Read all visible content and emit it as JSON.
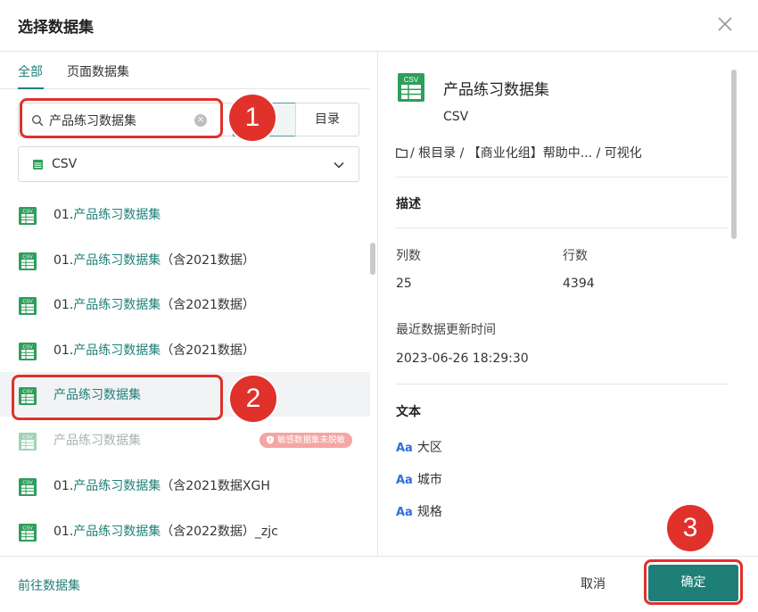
{
  "dialog": {
    "title": "选择数据集"
  },
  "tabs": [
    {
      "label": "全部",
      "active": true
    },
    {
      "label": "页面数据集",
      "active": false
    }
  ],
  "search": {
    "value": "产品练习数据集",
    "placeholder": ""
  },
  "toggle": {
    "option_blank": "",
    "option_directory": "目录"
  },
  "dataset_type_select": {
    "selected": "CSV",
    "icon": "table-icon"
  },
  "list": [
    {
      "prefix": "01.",
      "highlight": "产品练习数据集",
      "suffix": "",
      "selected": false,
      "disabled": false
    },
    {
      "prefix": "01.",
      "highlight": "产品练习数据集",
      "suffix": "（含2021数据）",
      "selected": false,
      "disabled": false
    },
    {
      "prefix": "01.",
      "highlight": "产品练习数据集",
      "suffix": "（含2021数据）",
      "selected": false,
      "disabled": false
    },
    {
      "prefix": "01.",
      "highlight": "产品练习数据集",
      "suffix": "（含2021数据）",
      "selected": false,
      "disabled": false
    },
    {
      "prefix": "",
      "highlight": "产品练习数据集",
      "suffix": "",
      "selected": true,
      "disabled": false
    },
    {
      "prefix": "",
      "highlight": "产品练习数据集",
      "suffix": "",
      "selected": false,
      "disabled": true,
      "badge": "敏感数据集未脱敏"
    },
    {
      "prefix": "01.",
      "highlight": "产品练习数据集",
      "suffix": "（含2021数据XGH",
      "selected": false,
      "disabled": false
    },
    {
      "prefix": "01.",
      "highlight": "产品练习数据集",
      "suffix": "（含2022数据）_zjc",
      "selected": false,
      "disabled": false
    }
  ],
  "details": {
    "icon_label": "CSV",
    "name": "产品练习数据集",
    "type": "CSV",
    "path": "/ 根目录 / 【商业化组】帮助中... / 可视化",
    "description_title": "描述",
    "columns_label": "列数",
    "columns_value": "25",
    "rows_label": "行数",
    "rows_value": "4394",
    "updated_label": "最近数据更新时间",
    "updated_value": "2023-06-26 18:29:30",
    "text_section_title": "文本",
    "fields": [
      {
        "type_icon": "Aa",
        "name": "大区"
      },
      {
        "type_icon": "Aa",
        "name": "城市"
      },
      {
        "type_icon": "Aa",
        "name": "规格"
      }
    ]
  },
  "footer": {
    "go_link": "前往数据集",
    "cancel": "取消",
    "confirm": "确定"
  },
  "annotations": {
    "step1": "1",
    "step2": "2",
    "step3": "3"
  },
  "colors": {
    "accent": "#1e7f78",
    "highlight_red": "#e0312b",
    "badge": "#f4a6a3",
    "field_icon": "#2f6fd6"
  }
}
